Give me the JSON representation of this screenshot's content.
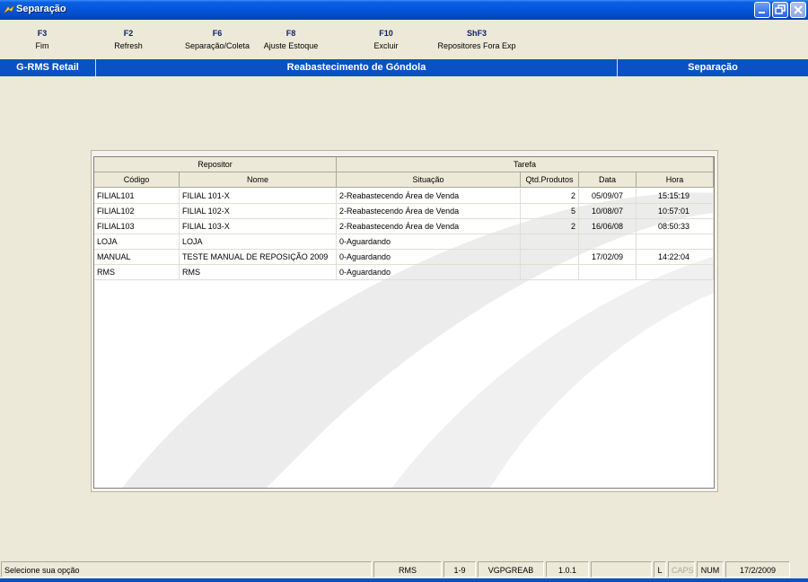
{
  "window": {
    "title": "Separação",
    "icon": "app-icon"
  },
  "function_keys": [
    {
      "key": "F3",
      "label": "Fim"
    },
    {
      "key": "F2",
      "label": "Refresh"
    },
    {
      "key": "F6",
      "label": "Separação/Coleta"
    },
    {
      "key": "F8",
      "label": "Ajuste Estoque"
    },
    {
      "key": "F10",
      "label": "Excluir"
    },
    {
      "key": "ShF3",
      "label": "Repositores Fora Exp"
    }
  ],
  "header_band": {
    "left": "G-RMS Retail",
    "center": "Reabastecimento de Góndola",
    "right": "Separação",
    "color": "#0a52c3"
  },
  "grid": {
    "groups": [
      "Repositor",
      "Tarefa"
    ],
    "columns": [
      "Código",
      "Nome",
      "Situação",
      "Qtd.Produtos",
      "Data",
      "Hora"
    ],
    "rows": [
      [
        "FILIAL101",
        "FILIAL 101-X",
        "2-Reabastecendo Área de Venda",
        "2",
        "05/09/07",
        "15:15:19"
      ],
      [
        "FILIAL102",
        "FILIAL 102-X",
        "2-Reabastecendo Área de Venda",
        "5",
        "10/08/07",
        "10:57:01"
      ],
      [
        "FILIAL103",
        "FILIAL 103-X",
        "2-Reabastecendo Área de Venda",
        "2",
        "16/06/08",
        "08:50:33"
      ],
      [
        "LOJA",
        "LOJA",
        "0-Aguardando",
        "",
        "",
        ""
      ],
      [
        "MANUAL",
        "TESTE MANUAL DE REPOSIÇÃO 2009",
        "0-Aguardando",
        "",
        "17/02/09",
        "14:22:04"
      ],
      [
        "RMS",
        "RMS",
        "0-Aguardando",
        "",
        "",
        ""
      ]
    ]
  },
  "status_bar": {
    "message": "Selecione sua opção",
    "user": "RMS",
    "range": "1-9",
    "program": "VGPGREAB",
    "version": "1.0.1",
    "empty": "",
    "l": "L",
    "caps": "CAPS",
    "num": "NUM",
    "date": "17/2/2009"
  }
}
